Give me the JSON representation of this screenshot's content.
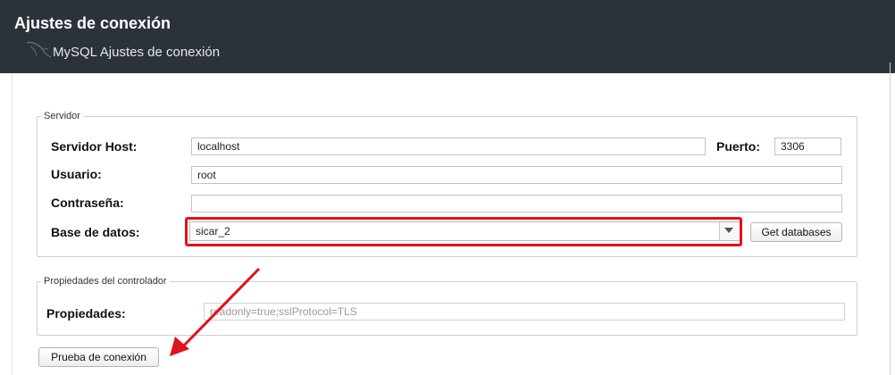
{
  "window": {
    "title": "Ajustes de conexión",
    "subtitle": "MySQL Ajustes de conexión"
  },
  "server_group": {
    "legend": "Servidor",
    "host_label": "Servidor Host:",
    "host_value": "localhost",
    "port_label": "Puerto:",
    "port_value": "3306",
    "user_label": "Usuario:",
    "user_value": "root",
    "password_label": "Contraseña:",
    "password_value": "",
    "database_label": "Base de datos:",
    "database_value": "sicar_2",
    "get_databases_label": "Get databases"
  },
  "driver_group": {
    "legend": "Propiedades del controlador",
    "properties_label": "Propiedades:",
    "properties_value": "readonly=true;sslProtocol=TLS"
  },
  "test_connection_label": "Prueba de conexión",
  "colors": {
    "header_bg": "#2b323a",
    "highlight": "#e1121b",
    "annotation_arrow": "#e1121b"
  },
  "icons": {
    "header_logo": "mysql-dolphin-icon",
    "dropdown": "chevron-down-icon"
  }
}
